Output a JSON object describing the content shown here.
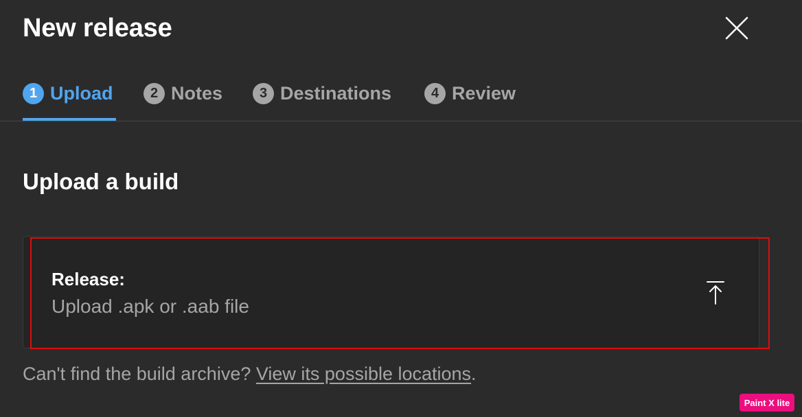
{
  "dialog": {
    "title": "New release",
    "close_icon": "close-icon"
  },
  "tabs": [
    {
      "number": "1",
      "label": "Upload",
      "active": true
    },
    {
      "number": "2",
      "label": "Notes",
      "active": false
    },
    {
      "number": "3",
      "label": "Destinations",
      "active": false
    },
    {
      "number": "4",
      "label": "Review",
      "active": false
    }
  ],
  "upload": {
    "heading": "Upload a build",
    "release_label": "Release:",
    "hint": "Upload .apk or .aab file",
    "icon": "upload-icon"
  },
  "help": {
    "text": "Can't find the build archive? ",
    "link": "View its possible locations",
    "suffix": "."
  },
  "watermark": {
    "text": "Paint X lite"
  },
  "colors": {
    "background": "#2b2b2b",
    "accent": "#50a5ee",
    "muted": "#a6a6a6",
    "highlight_border": "#e00c0c",
    "watermark": "#ec0e7e"
  }
}
